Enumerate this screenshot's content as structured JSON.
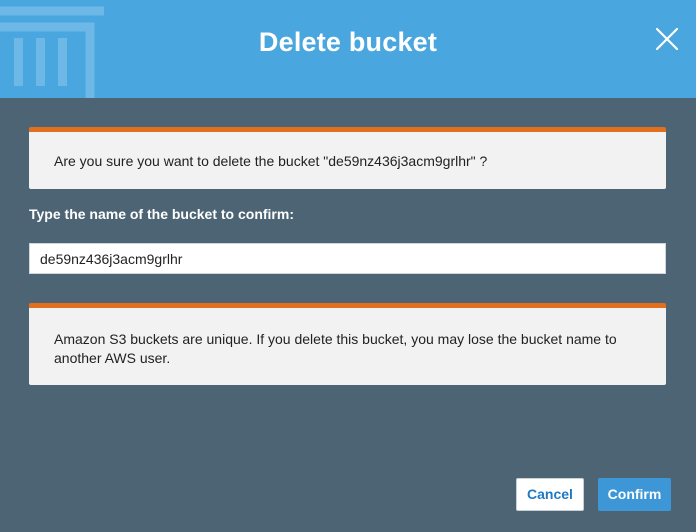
{
  "dialog": {
    "title": "Delete bucket",
    "warning_text": "Are you sure you want to delete the bucket \"de59nz436j3acm9grlhr\" ?",
    "confirm_label": "Type the name of the bucket to confirm:",
    "input_value": "de59nz436j3acm9grlhr",
    "info_text": "Amazon S3 buckets are unique. If you delete this bucket, you may lose the bucket name to another AWS user.",
    "cancel_label": "Cancel",
    "confirm_button_label": "Confirm"
  },
  "icons": {
    "header_decoration": "trash-icon",
    "close": "close-icon"
  },
  "colors": {
    "header_bg": "#4aa6de",
    "body_bg": "#4c6474",
    "accent_orange": "#e0701e",
    "panel_bg": "#f2f2f2",
    "primary_button": "#3d96d6",
    "link_blue": "#1f7ac3"
  }
}
